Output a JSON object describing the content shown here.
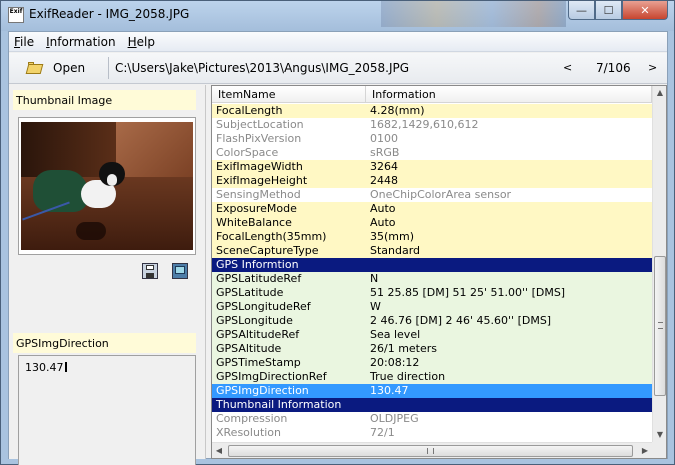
{
  "window": {
    "title": "ExifReader - IMG_2058.JPG",
    "icon_text": "Exif",
    "minimize": "—",
    "maximize": "☐",
    "close": "✕"
  },
  "menu": [
    {
      "label": "File",
      "accel": "F",
      "rest": "ile"
    },
    {
      "label": "Information",
      "accel": "I",
      "rest": "nformation"
    },
    {
      "label": "Help",
      "accel": "H",
      "rest": "elp"
    }
  ],
  "toolbar": {
    "open_label": "Open",
    "path": "C:\\Users\\Jake\\Pictures\\2013\\Angus\\IMG_2058.JPG",
    "prev": "<",
    "count": "7/106",
    "next": ">"
  },
  "left": {
    "thumbnail_header": "Thumbnail Image",
    "value_header": "GPSImgDirection",
    "value_text": "130.47"
  },
  "list": {
    "columns": [
      "ItemName",
      "Information"
    ],
    "rows": [
      {
        "style": "yellow",
        "name": "FocalLength",
        "info": "4.28(mm)"
      },
      {
        "style": "plain",
        "name": "SubjectLocation",
        "info": "1682,1429,610,612"
      },
      {
        "style": "plain",
        "name": "FlashPixVersion",
        "info": "0100"
      },
      {
        "style": "plain",
        "name": "ColorSpace",
        "info": "sRGB"
      },
      {
        "style": "yellow",
        "name": "ExifImageWidth",
        "info": "3264"
      },
      {
        "style": "yellow",
        "name": "ExifImageHeight",
        "info": "2448"
      },
      {
        "style": "plain",
        "name": "SensingMethod",
        "info": "OneChipColorArea sensor"
      },
      {
        "style": "yellow",
        "name": "ExposureMode",
        "info": "Auto"
      },
      {
        "style": "yellow",
        "name": "WhiteBalance",
        "info": "Auto"
      },
      {
        "style": "yellow",
        "name": "FocalLength(35mm)",
        "info": "35(mm)"
      },
      {
        "style": "yellow",
        "name": "SceneCaptureType",
        "info": "Standard"
      },
      {
        "style": "section",
        "name": "GPS Informtion",
        "info": ""
      },
      {
        "style": "green",
        "name": "GPSLatitudeRef",
        "info": "N"
      },
      {
        "style": "green",
        "name": "GPSLatitude",
        "info": "51 25.85 [DM]   51 25' 51.00'' [DMS]"
      },
      {
        "style": "green",
        "name": "GPSLongitudeRef",
        "info": "W"
      },
      {
        "style": "green",
        "name": "GPSLongitude",
        "info": "2 46.76 [DM]   2 46' 45.60'' [DMS]"
      },
      {
        "style": "green",
        "name": "GPSAltitudeRef",
        "info": "Sea level"
      },
      {
        "style": "green",
        "name": "GPSAltitude",
        "info": "26/1 meters"
      },
      {
        "style": "green",
        "name": "GPSTimeStamp",
        "info": "20:08:12"
      },
      {
        "style": "green",
        "name": "GPSImgDirectionRef",
        "info": "True direction"
      },
      {
        "style": "selected",
        "name": "GPSImgDirection",
        "info": "130.47"
      },
      {
        "style": "section",
        "name": "Thumbnail Information",
        "info": ""
      },
      {
        "style": "plain",
        "name": "Compression",
        "info": "OLDJPEG"
      },
      {
        "style": "plain",
        "name": "XResolution",
        "info": "72/1"
      }
    ]
  },
  "scrollbars": {
    "up": "▲",
    "down": "▼",
    "left": "◀",
    "right": "▶"
  }
}
